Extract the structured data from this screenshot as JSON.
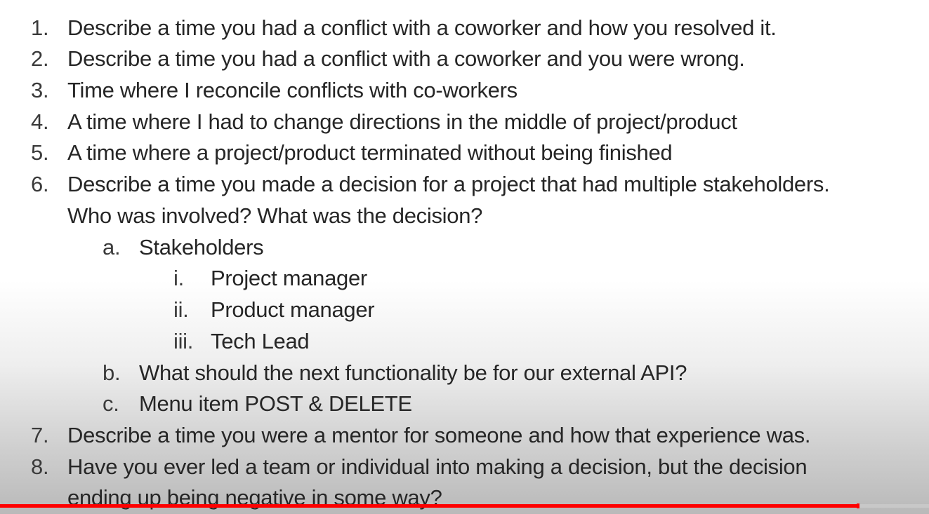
{
  "items": [
    {
      "marker": "1.",
      "text": "Describe a time you had a conflict with a coworker and how you resolved it."
    },
    {
      "marker": "2.",
      "text": "Describe a time you had a conflict with a coworker and you were wrong."
    },
    {
      "marker": "3.",
      "text": "Time where I reconcile conflicts with co-workers"
    },
    {
      "marker": "4.",
      "text": "A time where I had to change directions in the middle of project/product"
    },
    {
      "marker": "5.",
      "text": "A time where a project/product terminated without being finished"
    },
    {
      "marker": "6.",
      "text": "Describe a time you made a decision for a project that had multiple stakeholders.",
      "continuation": "Who was involved? What was the decision?"
    },
    {
      "marker": "7.",
      "text": "Describe a time you were a mentor for someone and how that experience was."
    },
    {
      "marker": "8.",
      "text": "Have you ever led a team or individual into making a decision, but the decision",
      "continuation": "ending up being negative in some way?"
    }
  ],
  "sub": [
    {
      "marker": "a.",
      "text": "Stakeholders"
    },
    {
      "marker": "b.",
      "text": "What should the next functionality be for our external API?"
    },
    {
      "marker": "c.",
      "text": "Menu item POST & DELETE"
    }
  ],
  "subsub": [
    {
      "marker": "i.",
      "text": "Project manager"
    },
    {
      "marker": "ii.",
      "text": "Product manager"
    },
    {
      "marker": "iii.",
      "text": "Tech Lead"
    }
  ],
  "video_progress": 0.924,
  "colors": {
    "progress": "#ff0000",
    "track": "#c8c8c8",
    "text": "#262626"
  }
}
